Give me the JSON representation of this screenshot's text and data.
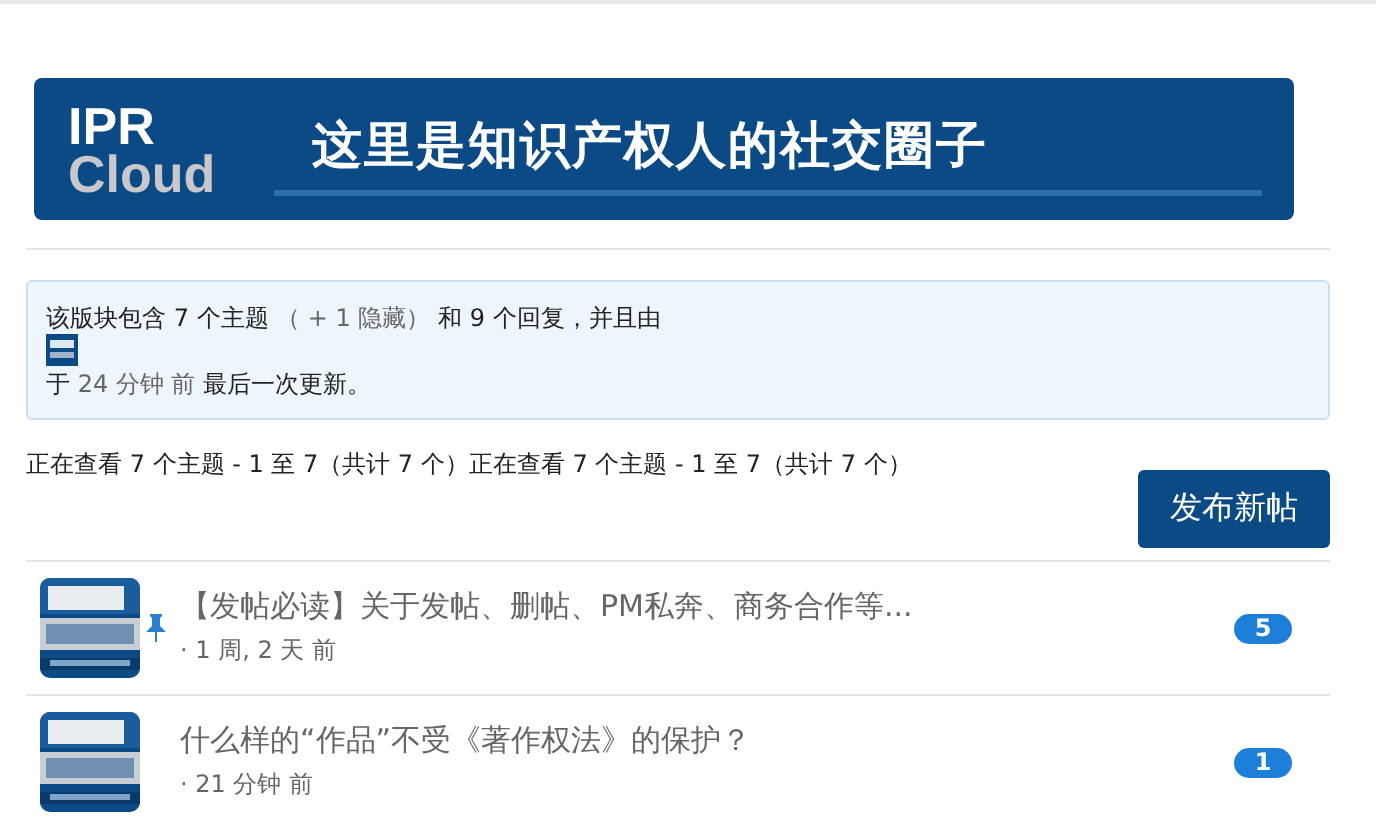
{
  "banner": {
    "logo_top": "IPR",
    "logo_bottom": "Cloud",
    "slogan": "这里是知识产权人的社交圈子"
  },
  "info": {
    "line1_parts": [
      "该版块包含 7 个主题",
      "（ + 1 隐藏）",
      "和 9 个回复，并且由"
    ],
    "line2_parts": [
      "于",
      "24 分钟 前",
      "最后一次更新。"
    ]
  },
  "pagination": "正在查看 7 个主题 - 1 至 7（共计 7 个）正在查看 7 个主题 - 1 至 7（共计 7 个）",
  "new_topic_button": "发布新帖",
  "topics": [
    {
      "title": "【发帖必读】关于发帖、删帖、PM私奔、商务合作等...",
      "sticky": true,
      "meta": "· 1 周, 2 天 前",
      "replies": "5"
    },
    {
      "title": "什么样的“作品”不受《著作权法》的保护？",
      "sticky": false,
      "meta": "· 21 分钟 前",
      "replies": "1"
    }
  ]
}
